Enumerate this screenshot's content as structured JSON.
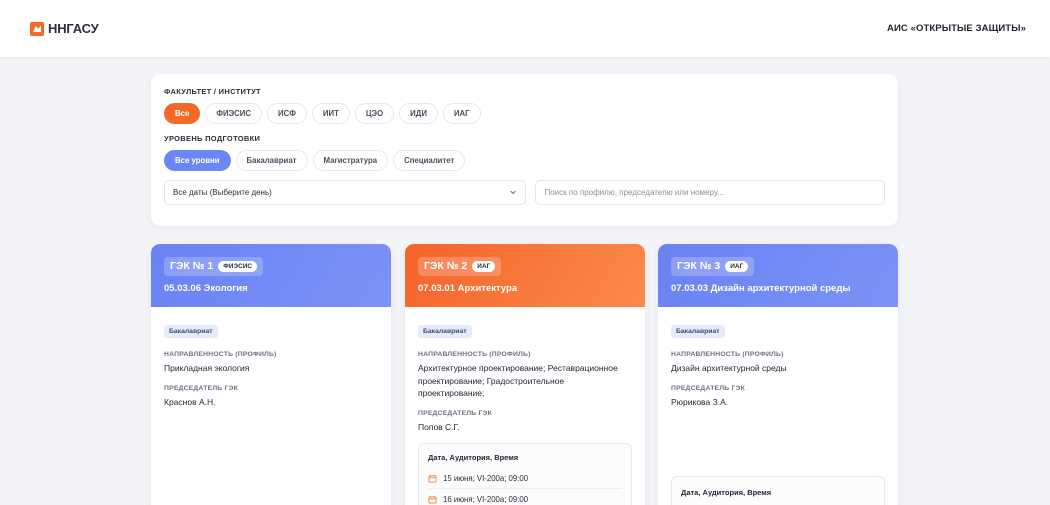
{
  "header": {
    "logo_text": "ННГАСУ",
    "system_title": "АИС «ОТКРЫТЫЕ ЗАЩИТЫ»"
  },
  "filters": {
    "faculty_label": "ФАКУЛЬТЕТ / ИНСТИТУТ",
    "faculties": [
      "Все",
      "ФИЭСИС",
      "ИСФ",
      "ИИТ",
      "ЦЭО",
      "ИДИ",
      "ИАГ"
    ],
    "faculty_selected": "Все",
    "level_label": "УРОВЕНЬ ПОДГОТОВКИ",
    "levels": [
      "Все уровни",
      "Бакалавриат",
      "Магистратура",
      "Специалитет"
    ],
    "level_selected": "Все уровни",
    "date_select_value": "Все даты (Выберите день)",
    "search_placeholder": "Поиск по профилю, председателю или номеру..."
  },
  "labels": {
    "profile": "НАПРАВЛЕННОСТЬ (ПРОФИЛЬ)",
    "chair": "ПРЕДСЕДАТЕЛЬ ГЭК",
    "schedule_title": "Дата, Аудитория, Время"
  },
  "cards": [
    {
      "gek": "ГЭК № 1",
      "institute": "ФИЭСИС",
      "code": "05.03.06 Экология",
      "level": "Бакалавриат",
      "profile": "Прикладная экология",
      "chair": "Краснов А.Н.",
      "schedule": []
    },
    {
      "gek": "ГЭК № 2",
      "institute": "ИАГ",
      "code": "07.03.01 Архитектура",
      "level": "Бакалавриат",
      "profile": "Архитектурное проектирование; Реставрационное проектирование; Градостроительное проектирование;",
      "chair": "Попов С.Г.",
      "schedule": [
        "15 июня; VI-200а; 09:00",
        "16 июня; VI-200а; 09:00"
      ]
    },
    {
      "gek": "ГЭК № 3",
      "institute": "ИАГ",
      "code": "07.03.03 Дизайн архитектурной среды",
      "level": "Бакалавриат",
      "profile": "Дизайн архитектурной среды",
      "chair": "Рюрикова З.А.",
      "schedule": []
    }
  ],
  "colors": {
    "accent_orange": "#f26a2a",
    "accent_blue": "#6b86f5",
    "calendar_icon": "#e8894a"
  }
}
